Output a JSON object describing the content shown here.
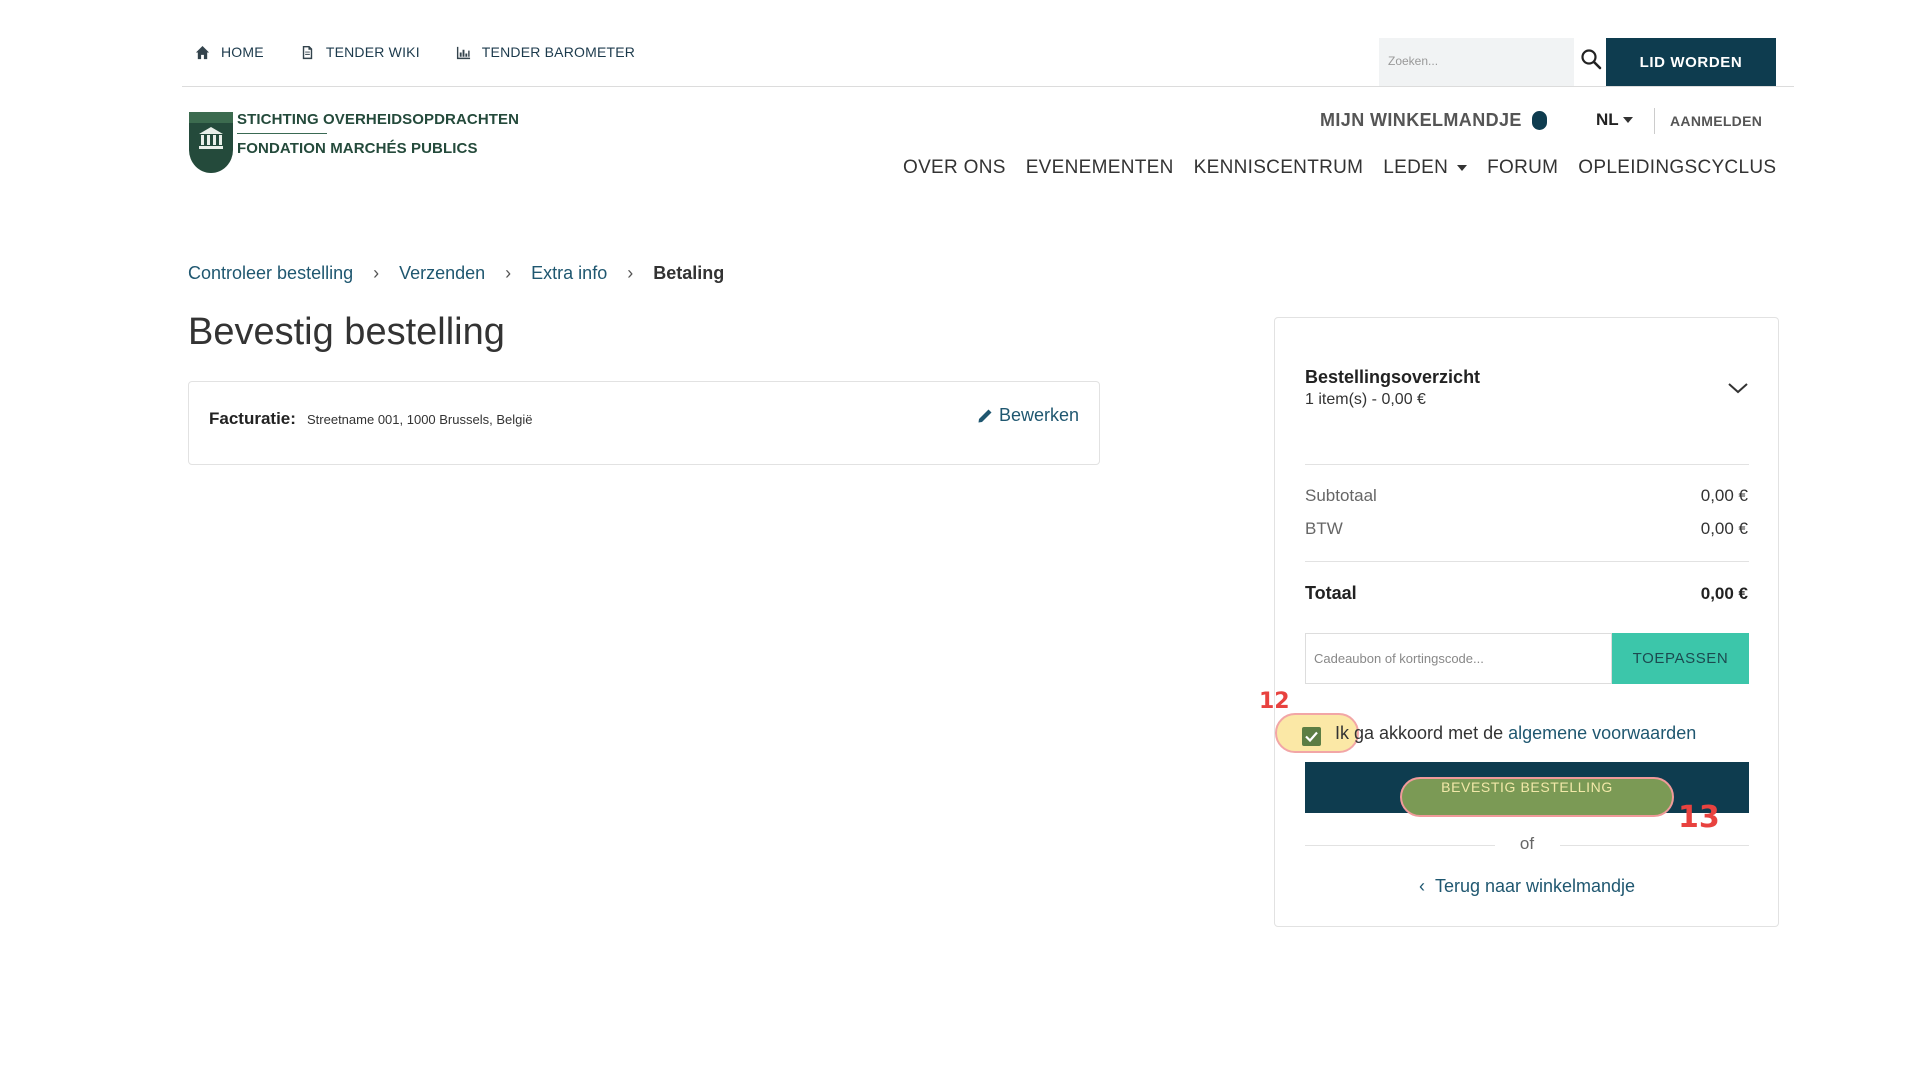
{
  "topbar": {
    "links": [
      {
        "label": "HOME",
        "icon": "home-icon"
      },
      {
        "label": "TENDER WIKI",
        "icon": "document-icon"
      },
      {
        "label": "TENDER BAROMETER",
        "icon": "bar-chart-icon"
      }
    ],
    "search_placeholder": "Zoeken...",
    "cta_label": "LID WORDEN"
  },
  "logo": {
    "line1": "STICHTING OVERHEIDSOPDRACHTEN",
    "line2": "FONDATION MARCHÉS PUBLICS"
  },
  "header": {
    "cart_label": "MIJN WINKELMANDJE",
    "language": "NL",
    "login_label": "AANMELDEN",
    "nav": [
      {
        "label": "OVER ONS"
      },
      {
        "label": "EVENEMENTEN"
      },
      {
        "label": "KENNISCENTRUM"
      },
      {
        "label": "LEDEN"
      },
      {
        "label": "FORUM"
      },
      {
        "label": "OPLEIDINGSCYCLUS"
      }
    ]
  },
  "breadcrumb": {
    "items": [
      "Controleer bestelling",
      "Verzenden",
      "Extra info"
    ],
    "current": "Betaling"
  },
  "page_title": "Bevestig bestelling",
  "billing": {
    "label": "Facturatie:",
    "address": "Streetname 001, 1000 Brussels, België",
    "edit_label": "Bewerken"
  },
  "summary": {
    "title": "Bestellingsoverzicht",
    "items_count": "1 item(s) -  0,00 €",
    "subtotal_label": "Subtotaal",
    "subtotal_value": "0,00 €",
    "vat_label": "BTW",
    "vat_value": "0,00 €",
    "total_label": "Totaal",
    "total_value": "0,00 €",
    "coupon_placeholder": "Cadeaubon of kortingscode...",
    "apply_label": "TOEPASSEN",
    "agree_prefix": "Ik ga akkoord met de ",
    "agree_link": "algemene voorwaarden",
    "agree_checked": true,
    "confirm_label": "BEVESTIG BESTELLING",
    "or_label": "of",
    "back_label": "Terug naar winkelmandje"
  },
  "annotations": {
    "step_checkbox": "12",
    "step_confirm": "13"
  },
  "colors": {
    "primary": "#0e3c4f",
    "accent": "#3cc6aa",
    "link": "#1f5770",
    "logo_green": "#244a3b",
    "marker": "#e8423f"
  }
}
